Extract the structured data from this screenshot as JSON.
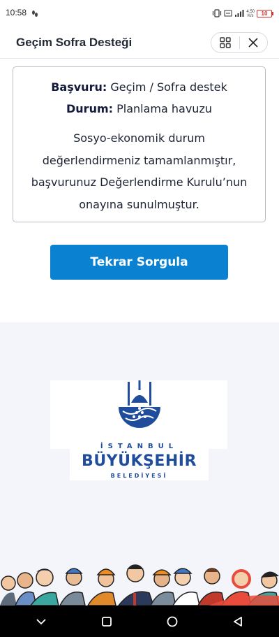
{
  "status_bar": {
    "time": "10:58",
    "net_speed_top": "4.50",
    "net_speed_bottom": "K/s",
    "battery": "10",
    "battery_color": "#d32f2f"
  },
  "app_header": {
    "title": "Geçim Sofra Desteği",
    "apps_icon": "grid-icon",
    "close_icon": "close-icon"
  },
  "result": {
    "application_label": "Başvuru:",
    "application_value": "Geçim / Sofra destek",
    "status_label": "Durum:",
    "status_value": "Planlama havuzu",
    "message": "Sosyo-ekonomik durum değerlendirmeniz tamamlanmıştır, başvurunuz Değerlendirme Kurulu’nun onayına sunulmuştur."
  },
  "retry_button": {
    "label": "Tekrar Sorgula",
    "color": "#0a82d1"
  },
  "logo": {
    "line1": "İSTANBUL",
    "line2": "BÜYÜKŞEHİR",
    "line3": "BELEDİYESİ",
    "color": "#1f4d9c"
  },
  "nav_bar": {
    "icons": [
      "chevron-down-icon",
      "square-icon",
      "circle-home-icon",
      "triangle-back-icon"
    ]
  }
}
